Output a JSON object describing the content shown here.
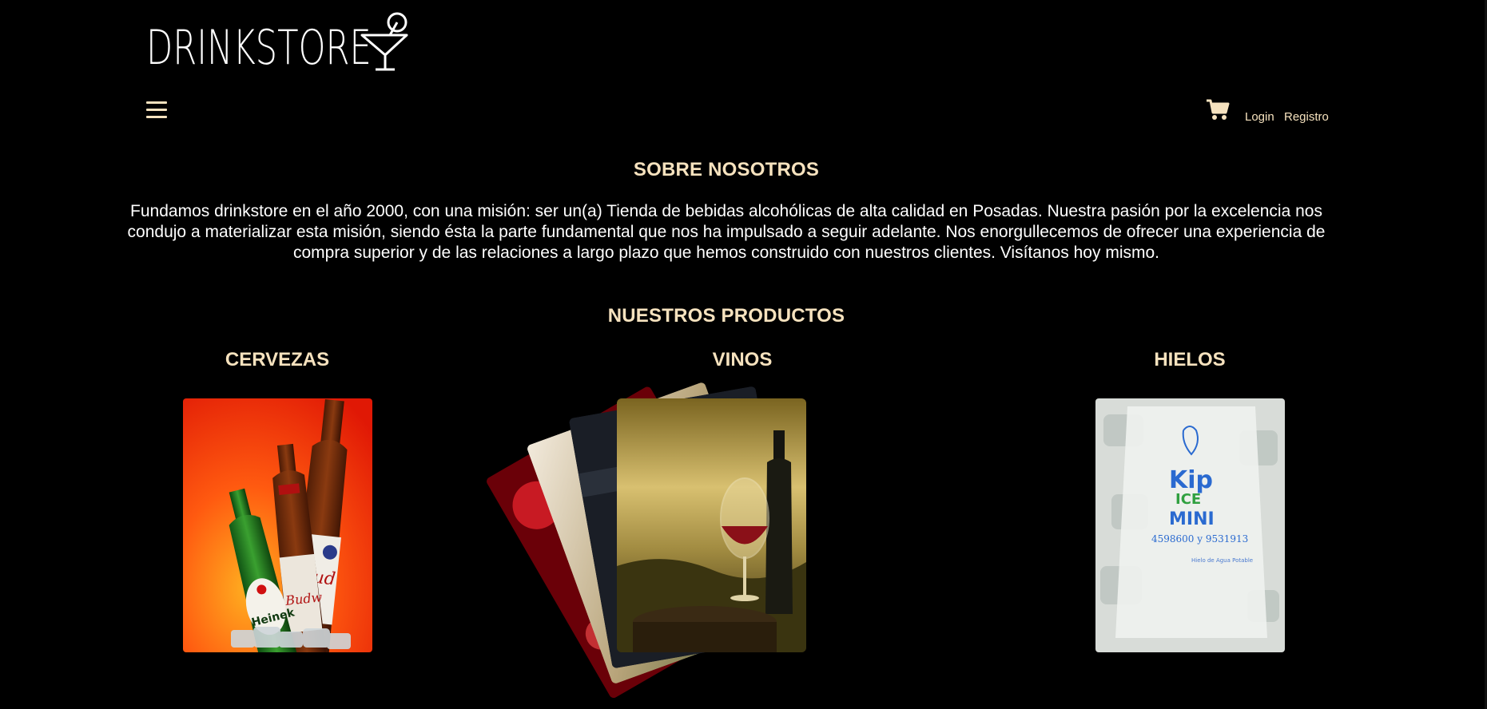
{
  "header": {
    "brand": "DRINKSTORE",
    "menu_icon": "hamburger-menu-icon",
    "cart_icon": "shopping-cart-icon",
    "login_label": "Login",
    "register_label": "Registro"
  },
  "about": {
    "title": "SOBRE NOSOTROS",
    "text": "Fundamos drinkstore en el año 2000, con una misión: ser un(a) Tienda de bebidas alcohólicas de alta calidad en Posadas. Nuestra pasión por la excelencia nos condujo a materializar esta misión, siendo ésta la parte fundamental que nos ha impulsado a seguir adelante. Nos enorgullecemos de ofrecer una experiencia de compra superior y de las relaciones a largo plazo que hemos construido con nuestros clientes. Visítanos hoy mismo."
  },
  "products": {
    "title": "NUESTROS PRODUCTOS",
    "categories": [
      {
        "label": "CERVEZAS"
      },
      {
        "label": "VINOS"
      },
      {
        "label": "HIELOS"
      }
    ]
  },
  "colors": {
    "background": "#000000",
    "accent": "#f6e2be",
    "text": "#ffffff"
  }
}
